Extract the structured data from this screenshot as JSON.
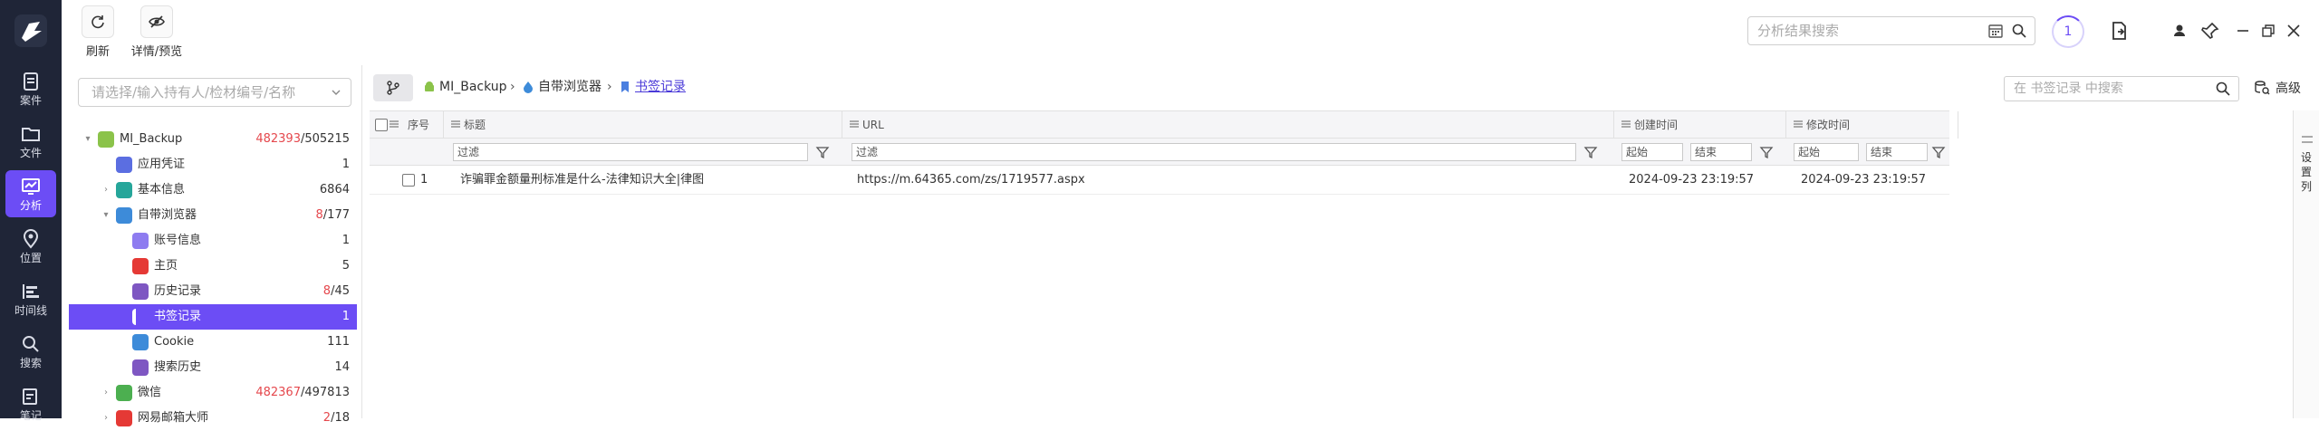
{
  "nav": {
    "items": [
      {
        "label": "案件",
        "icon": "case-icon"
      },
      {
        "label": "文件",
        "icon": "folder-icon"
      },
      {
        "label": "分析",
        "icon": "analysis-icon",
        "active": true
      },
      {
        "label": "位置",
        "icon": "location-icon"
      },
      {
        "label": "时间线",
        "icon": "timeline-icon"
      },
      {
        "label": "搜索",
        "icon": "search-icon"
      },
      {
        "label": "笔记",
        "icon": "note-icon"
      }
    ]
  },
  "toolbar": {
    "refresh_label": "刷新",
    "detail_label": "详情/预览",
    "search_placeholder": "分析结果搜索",
    "task_count": "1"
  },
  "left": {
    "case_placeholder": "请选择/输入持有人/检材编号/名称",
    "tree": [
      {
        "label": "MI_Backup",
        "count_red": "482393",
        "count": "/505215",
        "level": 0,
        "expanded": true,
        "icon_color": "#8bc34a"
      },
      {
        "label": "应用凭证",
        "count": "1",
        "level": 1,
        "icon_color": "#5b6ee1"
      },
      {
        "label": "基本信息",
        "count": "6864",
        "level": 1,
        "collapsed": true,
        "icon_color": "#26a69a"
      },
      {
        "label": "自带浏览器",
        "count_red": "8",
        "count": "/177",
        "level": 1,
        "expanded": true,
        "icon_color": "#3d8bd9"
      },
      {
        "label": "账号信息",
        "count": "1",
        "level": 2,
        "icon_color": "#8e7cf0"
      },
      {
        "label": "主页",
        "count": "5",
        "level": 2,
        "icon_color": "#e53935"
      },
      {
        "label": "历史记录",
        "count_red": "8",
        "count": "/45",
        "level": 2,
        "icon_color": "#7e57c2"
      },
      {
        "label": "书签记录",
        "count": "1",
        "level": 2,
        "selected": true,
        "icon_color": "#ffffff"
      },
      {
        "label": "Cookie",
        "count": "111",
        "level": 2,
        "icon_color": "#3d8bd9"
      },
      {
        "label": "搜索历史",
        "count": "14",
        "level": 2,
        "icon_color": "#7e57c2"
      },
      {
        "label": "微信",
        "count_red": "482367",
        "count": "/497813",
        "level": 1,
        "collapsed": true,
        "icon_color": "#4caf50"
      },
      {
        "label": "网易邮箱大师",
        "count_red": "2",
        "count": "/18",
        "level": 1,
        "collapsed": true,
        "icon_color": "#e53935"
      }
    ]
  },
  "breadcrumb": {
    "items": [
      "MI_Backup",
      "自带浏览器",
      "书签记录"
    ]
  },
  "main": {
    "record_search_placeholder": "在 书签记录 中搜索",
    "advanced_label": "高级",
    "settings_label": "设置列"
  },
  "grid": {
    "columns": {
      "index": "序号",
      "title": "标题",
      "url": "URL",
      "created": "创建时间",
      "modified": "修改时间"
    },
    "filter_placeholder": "过滤",
    "range_start": "起始",
    "range_end": "结束",
    "rows": [
      {
        "index": "1",
        "title": "诈骗罪金额量刑标准是什么-法律知识大全|律图",
        "url": "https://m.64365.com/zs/1719577.aspx",
        "created": "2024-09-23 23:19:57",
        "modified": "2024-09-23 23:19:57"
      }
    ]
  }
}
